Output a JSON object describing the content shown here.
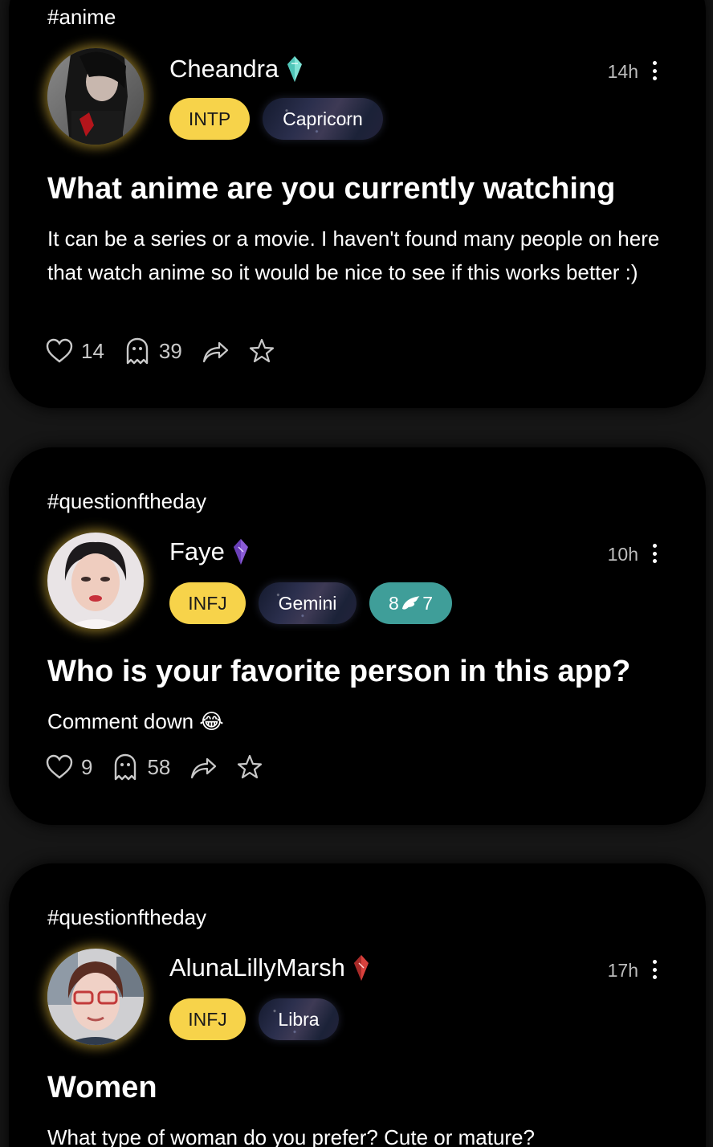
{
  "posts": [
    {
      "tag": "#anime",
      "username": "Cheandra",
      "time": "14h",
      "mbti": "INTP",
      "zodiac": "Capricorn",
      "title": "What anime are you currently watching",
      "body": "It can be a series or a movie. I haven't found many people on here that watch anime so it would be nice to see if this works better :)",
      "likes": "14",
      "comments": "39",
      "crystal_color": "#7fe3d6"
    },
    {
      "tag": "#questionftheday",
      "username": "Faye",
      "time": "10h",
      "mbti": "INFJ",
      "zodiac": "Gemini",
      "match_left": "8",
      "match_right": "7",
      "title": "Who is your favorite person in this app?",
      "body": "Comment down 😂",
      "likes": "9",
      "comments": "58",
      "crystal_color": "#8a5bd6"
    },
    {
      "tag": "#questionftheday",
      "username": "AlunaLillyMarsh",
      "time": "17h",
      "mbti": "INFJ",
      "zodiac": "Libra",
      "title": "Women",
      "body": "What type of woman do you prefer? Cute or mature?",
      "crystal_color": "#d9413d"
    }
  ],
  "colors": {
    "mbti_badge": "#f7d34a",
    "match_badge": "#3f9e99",
    "card_bg": "#000000",
    "page_bg": "#161616"
  },
  "icons": {
    "like": "heart-outline-icon",
    "comment": "ghost-icon",
    "share": "share-arrow-icon",
    "save": "star-icon",
    "menu": "more-vertical-icon",
    "match": "wings-icon"
  }
}
